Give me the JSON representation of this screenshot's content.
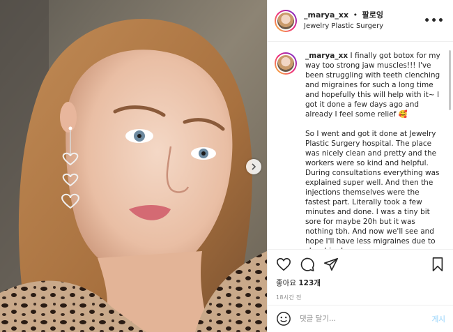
{
  "post": {
    "username": "_marya_xx",
    "separator": "•",
    "follow_label": "팔로잉",
    "location": "Jewelry Plastic Surgery",
    "more_icon": "more-horizontal-icon"
  },
  "caption": {
    "username": "_marya_xx",
    "paragraph_1": "I finally got botox for my way too strong jaw muscles!!! I've been struggling with teeth clenching and migraines for such a long time and hopefully this will help with it~ I got it done a few days ago and already I feel some relief 🥰",
    "paragraph_2": "So I went and got it done at Jewelry Plastic Surgery hospital. The place was nicely clean and pretty and the workers were so kind and helpful. During consultations everything was explained super well. And then the injections themselves were the fastest part. Literally took a few minutes and done. I was a tiny bit sore for maybe 20h but it was nothing tbh. And now we'll see and hope I'll have less migraines due to clenching!"
  },
  "actions": {
    "likes_prefix": "좋아요",
    "likes_count": "123개",
    "timestamp": "18시간 전"
  },
  "comment_box": {
    "placeholder": "댓글 달기...",
    "post_label": "게시"
  },
  "colors": {
    "accent": "#0095f6",
    "post_disabled": "#b2dffc",
    "border": "#efefef"
  }
}
